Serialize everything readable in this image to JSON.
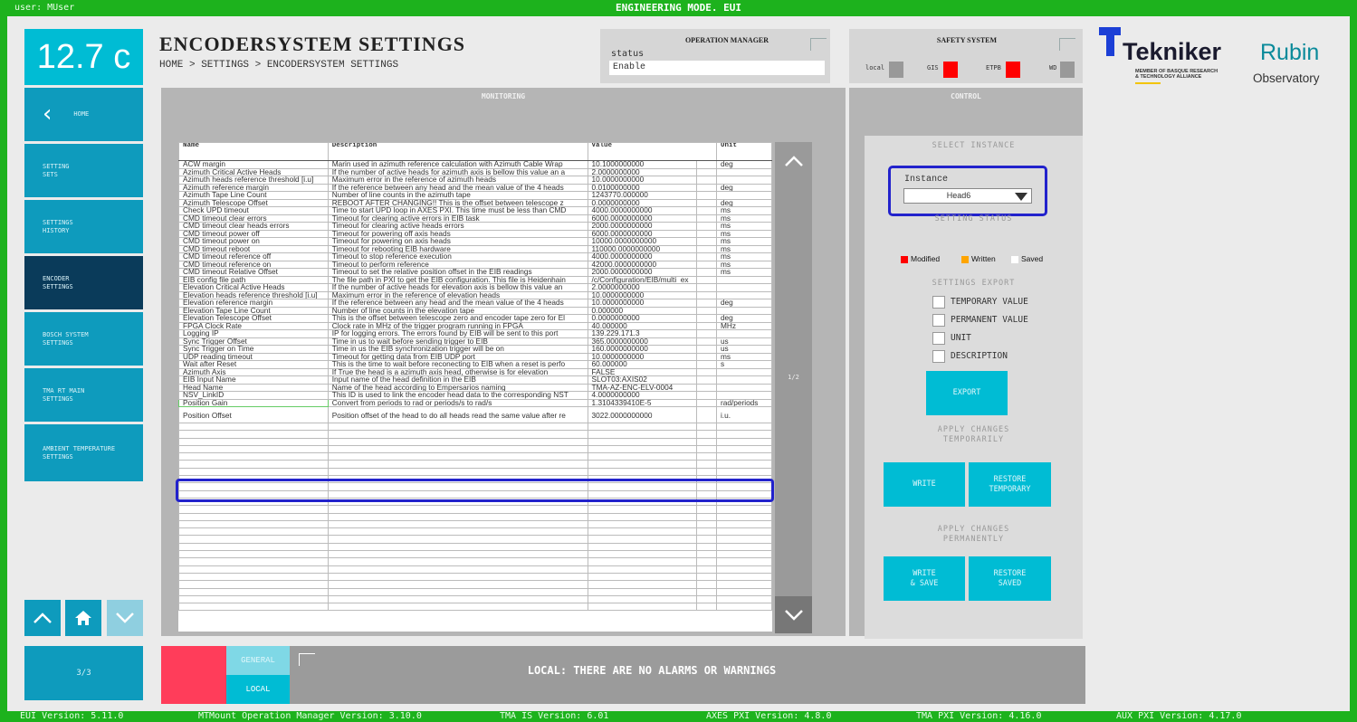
{
  "topbar": {
    "user": "user: MUser",
    "mode": "ENGINEERING MODE. EUI"
  },
  "temperature": "12.7 c",
  "nav": {
    "home": "HOME",
    "items": [
      "SETTING\nSETS",
      "SETTINGS\nHISTORY",
      "ENCODER\nSETTINGS",
      "BOSCH SYSTEM\nSETTINGS",
      "TMA RT MAIN\nSETTINGS",
      "AMBIENT TEMPERATURE\nSETTINGS"
    ],
    "page": "3/3"
  },
  "header": {
    "title": "ENCODERSYSTEM SETTINGS",
    "breadcrumb": "HOME > SETTINGS > ENCODERSYSTEM SETTINGS"
  },
  "operation_manager": {
    "title": "OPERATION MANAGER",
    "status_label": "status",
    "status_value": "Enable"
  },
  "safety": {
    "title": "SAFETY SYSTEM",
    "local": "local",
    "gis": "GIS",
    "etpb": "ETPB",
    "wd": "WD"
  },
  "logos": {
    "tekniker": "Tekniker",
    "tekniker_sub": "MEMBER OF BASQUE RESEARCH\n& TECHNOLOGY ALLIANCE",
    "rubin": "Rubin",
    "observatory": "Observatory"
  },
  "monitoring": {
    "title": "MONITORING",
    "page": "1/2",
    "columns": [
      "Name",
      "Description",
      "Value",
      "Unit"
    ],
    "rows": [
      [
        "ACW margin",
        "Marin used in azimuth reference calculation with Azimuth Cable Wrap",
        "10.1000000000",
        "deg"
      ],
      [
        "Azimuth Critical Active Heads",
        "If the number of active heads for azimuth axis is bellow this value an a",
        "2.0000000000",
        ""
      ],
      [
        "Azimuth heads reference threshold [i.u]",
        "Maximum error in the reference of azimuth heads",
        "10.0000000000",
        ""
      ],
      [
        "Azimuth reference margin",
        "If the reference between any head and the mean value of the 4 heads",
        "0.0100000000",
        "deg"
      ],
      [
        "Azimuth Tape Line Count",
        "Number of line counts in the azimuth tape",
        "1243770.000000",
        ""
      ],
      [
        "Azimuth Telescope Offset",
        "REBOOT AFTER CHANGING!! This is the offset between telescope z",
        "0.0000000000",
        "deg"
      ],
      [
        "Check UPD timeout",
        "Time to start UPD loop in AXES PXI. This time must be less than CMD",
        "4000.0000000000",
        "ms"
      ],
      [
        "CMD timeout clear errors",
        "Timeout for  clearing active errors in EIB task",
        "6000.0000000000",
        "ms"
      ],
      [
        "CMD timeout clear heads errors",
        "Timeout for  clearing active heads errors",
        "2000.0000000000",
        "ms"
      ],
      [
        "CMD timeout power off",
        "Timeout for  powering off axis heads",
        "6000.0000000000",
        "ms"
      ],
      [
        "CMD timeout power on",
        "Timeout for  powering on axis heads",
        "10000.0000000000",
        "ms"
      ],
      [
        "CMD timeout reboot",
        "Timeout for rebooting EIB hardware",
        "110000.0000000000",
        "ms"
      ],
      [
        "CMD timeout reference off",
        "Timeout to stop reference execution",
        "4000.0000000000",
        "ms"
      ],
      [
        "CMD timeout reference on",
        "Timeout to perform reference",
        "42000.0000000000",
        "ms"
      ],
      [
        "CMD timeout Relative Offset",
        "Timeout to set the relative position offset in the EIB readings",
        "2000.0000000000",
        "ms"
      ],
      [
        "EIB config file path",
        "The file path in PXI to get the EIB configuration. This file is Heidenhain",
        "/c/Configuration/EIB/multi_ex",
        ""
      ],
      [
        "Elevation Critical Active Heads",
        "If the number of active heads for elevation axis is bellow this value an",
        "2.0000000000",
        ""
      ],
      [
        "Elevation heads reference threshold [i.u]",
        "Maximum error in the reference of elevation heads",
        "10.0000000000",
        ""
      ],
      [
        "Elevation reference margin",
        "If the reference between any head and the mean value of the 4 heads",
        "10.0000000000",
        "deg"
      ],
      [
        "Elevation Tape Line Count",
        "Number of line counts in the elevation tape",
        "0.000000",
        ""
      ],
      [
        "Elevation Telescope Offset",
        "This is the offset between telescope zero and encoder tape zero for El",
        "0.0000000000",
        "deg"
      ],
      [
        "FPGA Clock Rate",
        "Clock rate in MHz of the trigger program running in FPGA",
        "40.000000",
        "MHz"
      ],
      [
        "Logging IP",
        "IP for logging errors. The errors found by EIB will be sent to this port",
        "139.229.171.3",
        ""
      ],
      [
        "Sync Trigger Offset",
        "Time in us to wait before sending trigger to EIB",
        "365.0000000000",
        "us"
      ],
      [
        "Sync Trigger on Time",
        "Time in us the EIB synchronization trigger will be on",
        "160.0000000000",
        "us"
      ],
      [
        "UDP reading timeout",
        "Timeout for getting data from EIB UDP port",
        "10.0000000000",
        "ms"
      ],
      [
        "Wait after Reset",
        "This is the time to wait before reconecting to EIB when a reset is perfo",
        "60.000000",
        "s"
      ],
      [
        "Azimuth Axis",
        "If True the head is a azimuth axis head, otherwise is for elevation",
        "FALSE",
        ""
      ],
      [
        "EIB Input Name",
        "Input name of the head definition in the EIB",
        "SLOT03:AXIS02",
        ""
      ],
      [
        "Head Name",
        "Name of the head according to Empersarios naming",
        "TMA-AZ-ENC-ELV-0004",
        ""
      ],
      [
        "NSV_LinkID",
        "This ID is used to link the encoder head data to the corresponding NST",
        "4.0000000000",
        ""
      ],
      [
        "Position Gain",
        "Convert from periods to rad or periods/s to rad/s",
        "1.3104339410E-5",
        "rad/periods"
      ],
      [
        "Position Offset",
        "Position offset of the head to do all heads read the same value after re",
        "3022.0000000000",
        "i.u."
      ]
    ]
  },
  "control": {
    "title": "CONTROL",
    "select_instance": "SELECT INSTANCE",
    "instance_label": "Instance",
    "instance_value": "Head6",
    "setting_status": "SETTING STATUS",
    "legend": [
      "Modified",
      "Written",
      "Saved"
    ],
    "settings_export": "SETTINGS EXPORT",
    "export_options": [
      "TEMPORARY VALUE",
      "PERMANENT VALUE",
      "UNIT",
      "DESCRIPTION"
    ],
    "export_btn": "EXPORT",
    "apply_temp": "APPLY CHANGES\nTEMPORARILY",
    "write": "WRITE",
    "restore_temp": "RESTORE\nTEMPORARY",
    "apply_perm": "APPLY CHANGES\nPERMANENTLY",
    "write_save": "WRITE\n& SAVE",
    "restore_saved": "RESTORE\nSAVED"
  },
  "alarms": {
    "general": "GENERAL",
    "local": "LOCAL",
    "message": "LOCAL: THERE ARE NO ALARMS OR WARNINGS"
  },
  "footer": [
    "EUI Version: 5.11.0",
    "MTMount Operation Manager Version: 3.10.0",
    "TMA IS Version: 6.01",
    "AXES PXI Version: 4.8.0",
    "TMA PXI Version: 4.16.0",
    "AUX PXI Version: 4.17.0"
  ]
}
